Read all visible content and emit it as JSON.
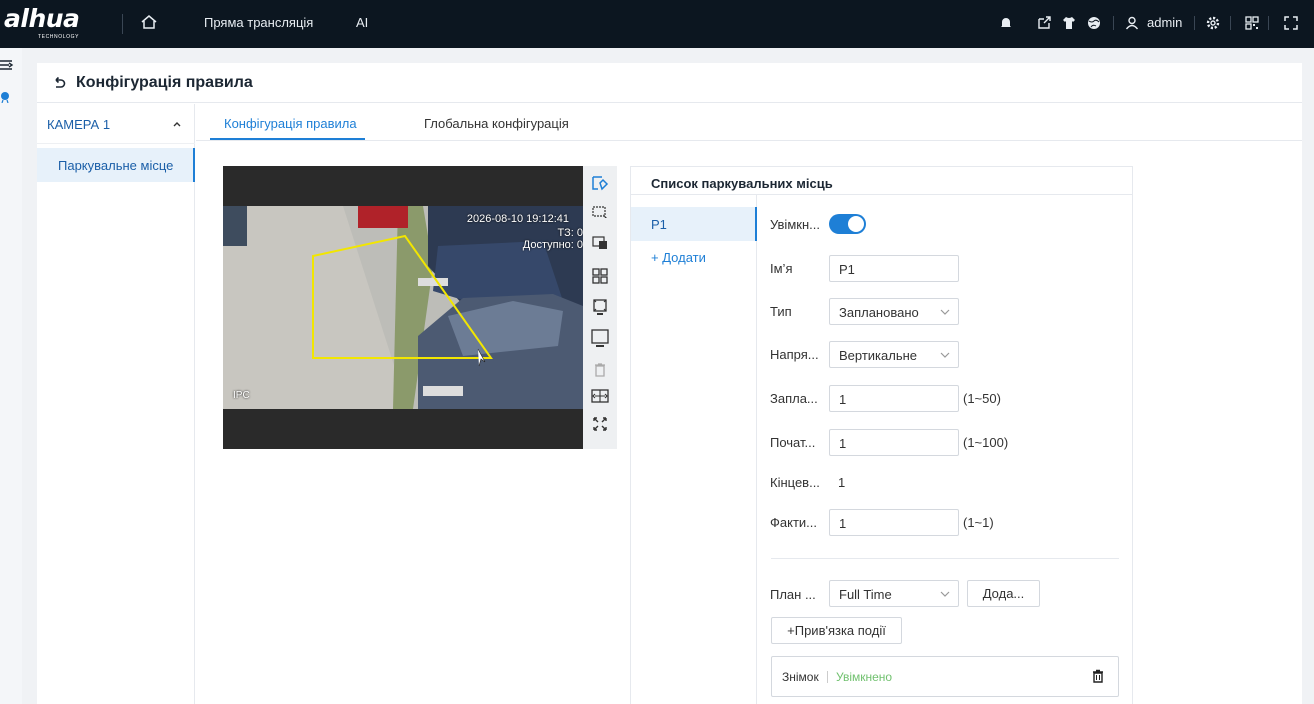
{
  "topbar": {
    "logo": "a‍hua",
    "logo_text": "alhua",
    "logo_tagline": "TECHNOLOGY",
    "nav": [
      "Пряма трансляція",
      "AI"
    ],
    "user": "admin"
  },
  "page": {
    "title": "Конфігурація правила"
  },
  "sidebar": {
    "camera": "КАМЕРА 1",
    "items": [
      {
        "label": "Паркувальне місце"
      }
    ]
  },
  "tabs": [
    {
      "label": "Конфігурація правила",
      "active": true
    },
    {
      "label": "Глобальна конфігурація",
      "active": false
    }
  ],
  "video": {
    "timestamp": "2026-08-10 19:12:41",
    "osd_line1": "ТЗ: 0",
    "osd_line2": "Доступно: 0",
    "channel": "IPC"
  },
  "parking_list": {
    "title": "Список паркувальних місць",
    "items": [
      {
        "label": "P1"
      }
    ],
    "add_label": "Додати"
  },
  "form": {
    "enable_label": "Увімкн...",
    "enabled": true,
    "name_label": "Ім’я",
    "name_value": "P1",
    "type_label": "Тип",
    "type_value": "Заплановано",
    "direction_label": "Напря...",
    "direction_value": "Вертикальне",
    "planned_label": "Запла...",
    "planned_value": "1",
    "planned_range": "(1~50)",
    "start_label": "Почат...",
    "start_value": "1",
    "start_range": "(1~100)",
    "end_label": "Кінцев...",
    "end_value": "1",
    "actual_label": "Факти...",
    "actual_value": "1",
    "actual_range": "(1~1)",
    "schedule_label": "План ...",
    "schedule_value": "Full Time",
    "add_schedule_button": "Дода...",
    "link_event_button": "+Прив'язка події",
    "snapshot_label": "Знімок",
    "snapshot_status": "Увімкнено"
  },
  "colors": {
    "accent": "#1e7fd6",
    "topbar": "#0c1620",
    "enabled_green": "#71c16f",
    "zone": "#f2e600"
  }
}
